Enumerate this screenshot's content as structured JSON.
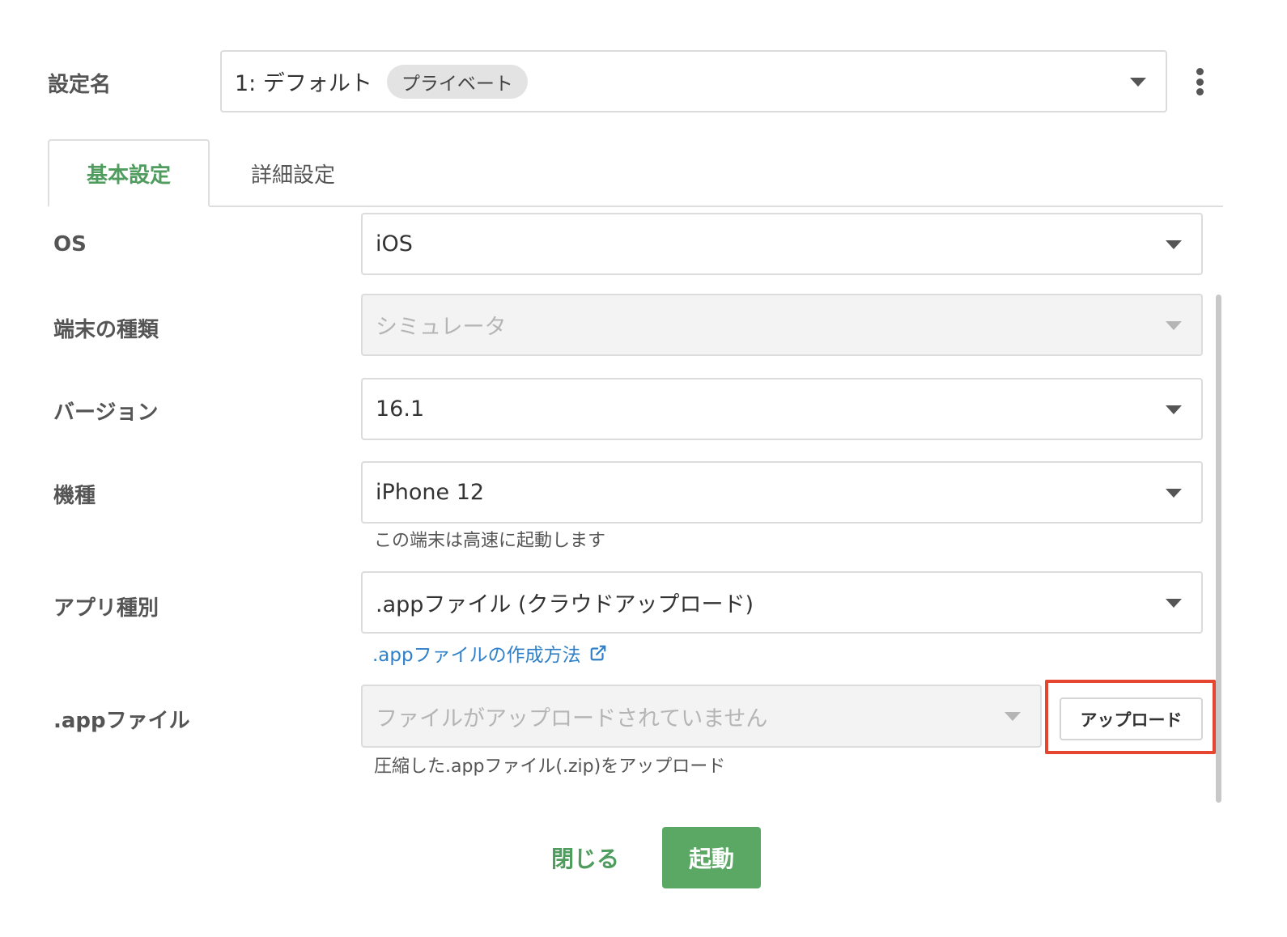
{
  "header": {
    "config_label": "設定名",
    "config_value": "1: デフォルト",
    "config_badge": "プライベート"
  },
  "tabs": [
    {
      "label": "基本設定",
      "active": true
    },
    {
      "label": "詳細設定",
      "active": false
    }
  ],
  "form": {
    "os": {
      "label": "OS",
      "value": "iOS"
    },
    "device_type": {
      "label": "端末の種類",
      "value": "シミュレータ",
      "disabled": true
    },
    "version": {
      "label": "バージョン",
      "value": "16.1"
    },
    "model": {
      "label": "機種",
      "value": "iPhone 12",
      "hint": "この端末は高速に起動します"
    },
    "app_type": {
      "label": "アプリ種別",
      "value": ".appファイル (クラウドアップロード)",
      "link_text": ".appファイルの作成方法"
    },
    "app_file": {
      "label": ".appファイル",
      "placeholder": "ファイルがアップロードされていません",
      "upload_label": "アップロード",
      "hint": "圧縮した.appファイル(.zip)をアップロード"
    }
  },
  "footer": {
    "close_label": "閉じる",
    "start_label": "起動"
  },
  "icons": {
    "dropdown": "caret-down-icon",
    "menu": "kebab-menu-icon",
    "external_link": "external-link-icon"
  },
  "colors": {
    "accent_green": "#4f9c5e",
    "button_green": "#5aa864",
    "link_blue": "#2f80c8",
    "highlight_red": "#e5462f"
  }
}
